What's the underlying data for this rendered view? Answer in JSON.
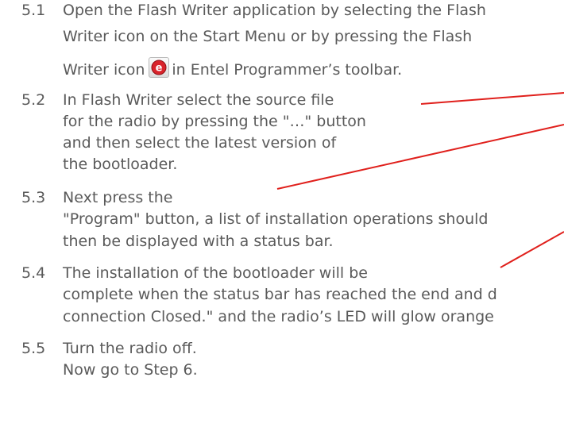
{
  "steps": [
    {
      "number": "5.1",
      "lines": [
        "Open the Flash Writer application by selecting the Flash",
        "Writer icon on the Start Menu or by pressing the Flash",
        "Writer icon",
        "in Entel Programmer’s toolbar."
      ],
      "icon": "entel-e-icon"
    },
    {
      "number": "5.2",
      "lines": [
        "In Flash Writer select the source file",
        "for the radio by pressing the \"…\" button",
        "and then select the latest version of",
        "the bootloader."
      ]
    },
    {
      "number": "5.3",
      "lines": [
        "Next press the",
        "\"Program\" button, a list of installation operations should",
        "then be displayed with a status bar."
      ]
    },
    {
      "number": "5.4",
      "lines": [
        "The installation of the bootloader will be",
        "complete when the status bar has reached the end and d",
        "connection Closed.\" and the radio’s LED will glow orange"
      ]
    },
    {
      "number": "5.5",
      "lines": [
        "Turn the radio off.",
        "Now go to Step 6."
      ]
    }
  ],
  "colors": {
    "text": "#5a5a5a",
    "callout_line": "#e0201c",
    "icon_red": "#d9232b"
  }
}
